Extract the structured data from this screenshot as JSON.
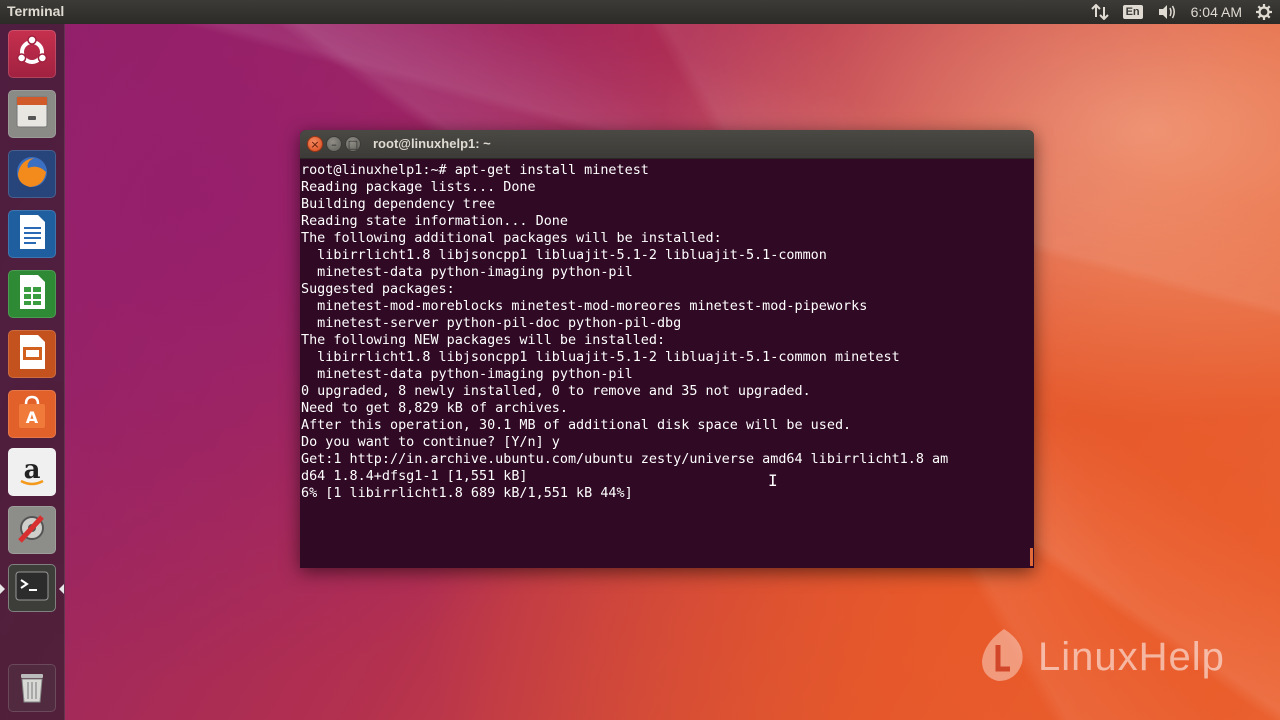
{
  "top_panel": {
    "app_title": "Terminal",
    "network_icon": "network-arrows-icon",
    "keyboard_layout": "En",
    "volume_icon": "volume-icon",
    "clock": "6:04 AM",
    "settings_icon": "gear-icon"
  },
  "launcher": {
    "items": [
      {
        "name": "ubuntu-dash",
        "icon": "ubuntu-logo-icon"
      },
      {
        "name": "files",
        "icon": "file-cabinet-icon"
      },
      {
        "name": "firefox",
        "icon": "firefox-icon"
      },
      {
        "name": "libreoffice-writer",
        "icon": "writer-document-icon"
      },
      {
        "name": "libreoffice-calc",
        "icon": "calc-spreadsheet-icon"
      },
      {
        "name": "libreoffice-impress",
        "icon": "impress-presentation-icon"
      },
      {
        "name": "ubuntu-software",
        "icon": "software-bag-icon"
      },
      {
        "name": "amazon",
        "icon": "amazon-icon"
      },
      {
        "name": "system-settings",
        "icon": "settings-tools-icon"
      },
      {
        "name": "terminal",
        "icon": "terminal-icon"
      },
      {
        "name": "trash",
        "icon": "trash-icon"
      }
    ]
  },
  "terminal_window": {
    "title": "root@linuxhelp1: ~",
    "close_glyph": "×",
    "min_glyph": "–",
    "max_glyph": "□",
    "lines": [
      "root@linuxhelp1:~# apt-get install minetest",
      "Reading package lists... Done",
      "Building dependency tree",
      "Reading state information... Done",
      "The following additional packages will be installed:",
      "  libirrlicht1.8 libjsoncpp1 libluajit-5.1-2 libluajit-5.1-common",
      "  minetest-data python-imaging python-pil",
      "Suggested packages:",
      "  minetest-mod-moreblocks minetest-mod-moreores minetest-mod-pipeworks",
      "  minetest-server python-pil-doc python-pil-dbg",
      "The following NEW packages will be installed:",
      "  libirrlicht1.8 libjsoncpp1 libluajit-5.1-2 libluajit-5.1-common minetest",
      "  minetest-data python-imaging python-pil",
      "0 upgraded, 8 newly installed, 0 to remove and 35 not upgraded.",
      "Need to get 8,829 kB of archives.",
      "After this operation, 30.1 MB of additional disk space will be used.",
      "Do you want to continue? [Y/n] y",
      "Get:1 http://in.archive.ubuntu.com/ubuntu zesty/universe amd64 libirrlicht1.8 am",
      "d64 1.8.4+dfsg1-1 [1,551 kB]",
      "6% [1 libirrlicht1.8 689 kB/1,551 kB 44%]"
    ],
    "text_color": "#ffffff",
    "background_color": "#300a24"
  },
  "watermark": {
    "text": "LinuxHelp",
    "icon": "linuxhelp-logo-icon"
  }
}
